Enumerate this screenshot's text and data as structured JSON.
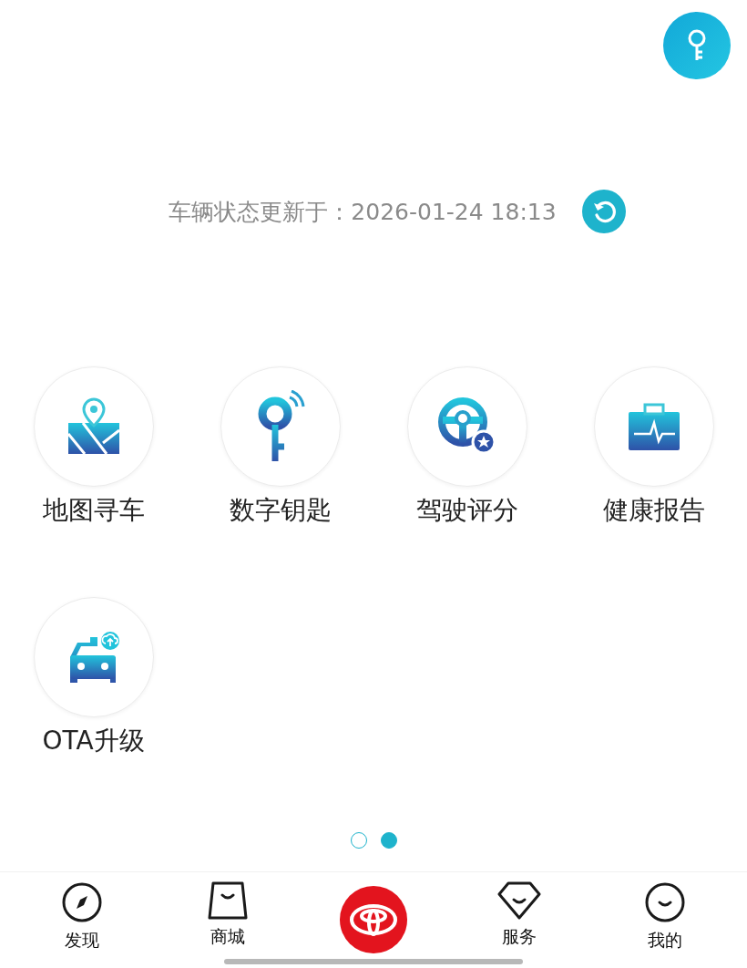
{
  "status": {
    "text": "车辆状态更新于：2026-01-24 18:13"
  },
  "features": [
    {
      "label": "地图寻车",
      "kind": "map"
    },
    {
      "label": "数字钥匙",
      "kind": "key"
    },
    {
      "label": "驾驶评分",
      "kind": "wheel"
    },
    {
      "label": "健康报告",
      "kind": "health"
    },
    {
      "label": "OTA升级",
      "kind": "ota"
    }
  ],
  "pager": [
    {
      "selected": false
    },
    {
      "selected": true
    }
  ],
  "tabs": [
    {
      "label": "发现",
      "kind": "compass"
    },
    {
      "label": "商城",
      "kind": "bag"
    },
    {
      "kind": "brand"
    },
    {
      "label": "服务",
      "kind": "diamond"
    },
    {
      "label": "我的",
      "kind": "smile"
    }
  ]
}
